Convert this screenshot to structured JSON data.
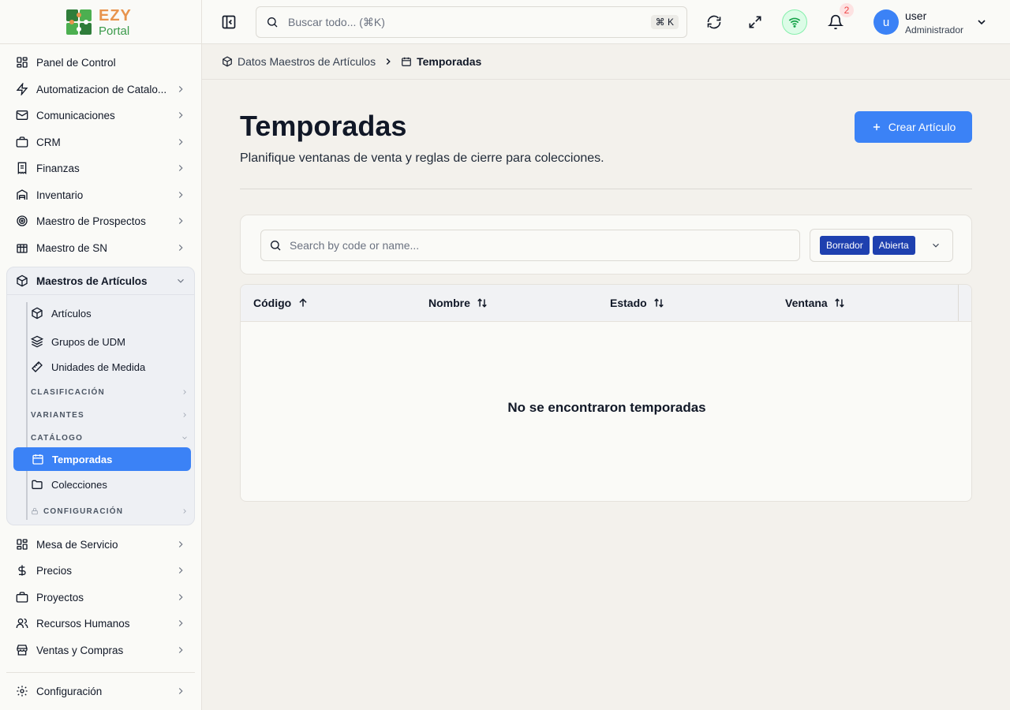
{
  "logo": {
    "brand": "EZY",
    "product": "Portal"
  },
  "sidebar": {
    "items_top": [
      {
        "label": "Panel de Control",
        "icon": "grid-icon"
      },
      {
        "label": "Automatizacion de Catalo...",
        "icon": "zap-icon"
      },
      {
        "label": "Comunicaciones",
        "icon": "mail-icon"
      },
      {
        "label": "CRM",
        "icon": "briefcase-icon"
      },
      {
        "label": "Finanzas",
        "icon": "receipt-icon"
      },
      {
        "label": "Inventario",
        "icon": "warehouse-icon"
      },
      {
        "label": "Maestro de Prospectos",
        "icon": "target-icon"
      },
      {
        "label": "Maestro de SN",
        "icon": "building-icon"
      }
    ],
    "group": {
      "label": "Maestros de Artículos",
      "items": [
        {
          "label": "Artículos",
          "icon": "box-icon"
        },
        {
          "label": "Grupos de UDM",
          "icon": "layers-icon"
        },
        {
          "label": "Unidades de Medida",
          "icon": "ruler-icon"
        }
      ],
      "categories": {
        "clasificacion": "CLASIFICACIÓN",
        "variantes": "VARIANTES",
        "catalogo": "CATÁLOGO",
        "configuracion": "CONFIGURACIÓN"
      },
      "catalog_items": [
        {
          "label": "Temporadas",
          "icon": "calendar-icon",
          "active": true
        },
        {
          "label": "Colecciones",
          "icon": "folder-icon",
          "active": false
        }
      ]
    },
    "items_bottom": [
      {
        "label": "Mesa de Servicio",
        "icon": "grid-icon"
      },
      {
        "label": "Precios",
        "icon": "dollar-icon"
      },
      {
        "label": "Proyectos",
        "icon": "briefcase-icon"
      },
      {
        "label": "Recursos Humanos",
        "icon": "users-icon"
      },
      {
        "label": "Ventas y Compras",
        "icon": "store-icon"
      }
    ],
    "settings": {
      "label": "Configuración",
      "icon": "gear-icon"
    }
  },
  "topbar": {
    "search_placeholder": "Buscar todo... (⌘K)",
    "shortcut": "⌘ K",
    "notification_count": "2",
    "user_initial": "u",
    "user_name": "user",
    "user_role": "Administrador"
  },
  "breadcrumb": {
    "parent": "Datos Maestros de Artículos",
    "current": "Temporadas"
  },
  "page": {
    "title": "Temporadas",
    "subtitle": "Planifique ventanas de venta y reglas de cierre para colecciones.",
    "create_button": "Crear Artículo"
  },
  "filters": {
    "search_placeholder": "Search by code or name...",
    "status_chips": [
      "Borrador",
      "Abierta"
    ]
  },
  "table": {
    "columns": [
      "Código",
      "Nombre",
      "Estado",
      "Ventana"
    ],
    "empty_message": "No se encontraron temporadas"
  },
  "colors": {
    "accent": "#3b82f6",
    "chip": "#1e40af",
    "logo_orange": "#e8944d",
    "logo_green": "#3a9a4a"
  }
}
